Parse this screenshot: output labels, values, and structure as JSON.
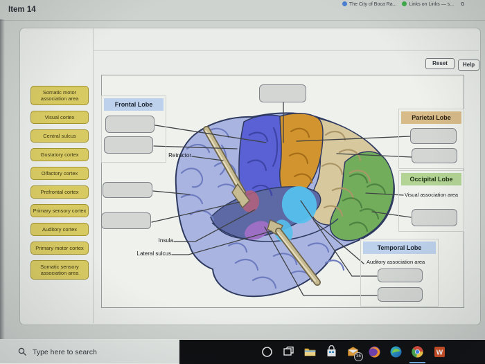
{
  "browser": {
    "bookmark_1": "The City of Boca Ra...",
    "bookmark_2": "Links on Links — s...",
    "bookmark_3": "G"
  },
  "header": {
    "item_title": "Item 14"
  },
  "controls": {
    "reset": "Reset",
    "help": "Help"
  },
  "word_bank": {
    "items": [
      "Somatic motor association area",
      "Visual cortex",
      "Central sulcus",
      "Gustatory cortex",
      "Olfactory cortex",
      "Prefrontal cortex",
      "Primary sensory cortex",
      "Auditory cortex",
      "Primary motor cortex",
      "Somatic sensory association area"
    ]
  },
  "diagram": {
    "frontal_lobe_label": "Frontal Lobe",
    "parietal_lobe_label": "Parietal Lobe",
    "occipital_lobe_label": "Occipital Lobe",
    "temporal_lobe_label": "Temporal Lobe",
    "visual_association_label": "Visual association area",
    "auditory_association_label": "Auditory association area",
    "retractor_label": "Retractor",
    "insula_label": "Insula",
    "lateral_sulcus_label": "Lateral sulcus"
  },
  "taskbar": {
    "search_placeholder": "Type here to search",
    "mail_badge": "35"
  },
  "colors": {
    "word_bank_label": "#d8ca62",
    "frontal_header": "#bdd1ec",
    "parietal_header": "#d7bb89",
    "occipital_header": "#b3d495",
    "temporal_header": "#bdd1ec",
    "brain_base": "#a9b4e1",
    "premotor_blue": "#5a61d4",
    "motor_strip_orange": "#d2942e",
    "parietal_tan": "#d8c89e",
    "occipital_green": "#72ad5c",
    "auditory_cyan": "#55c0ec",
    "insula_purple": "#9c6fc4",
    "retractor_tan": "#c7bb92"
  }
}
